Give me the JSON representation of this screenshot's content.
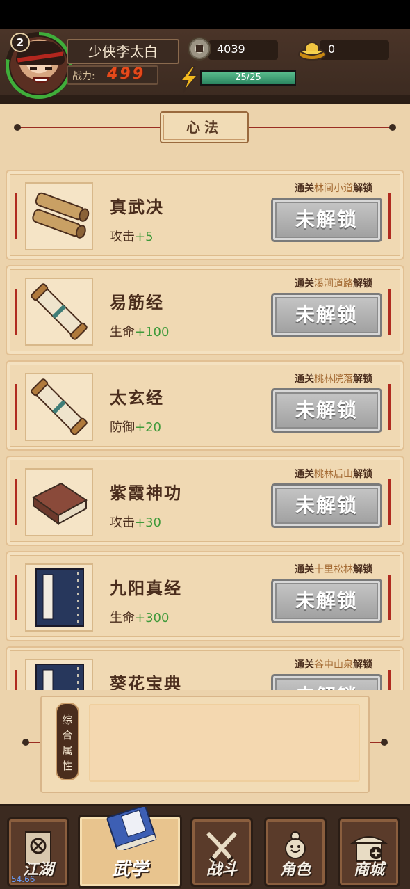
{
  "player": {
    "level": "2",
    "name": "少侠李太白",
    "power_label": "战力:",
    "power_value": "499",
    "coins": "4039",
    "ingots": "0",
    "energy_text": "25/25",
    "energy_fraction": 1.0
  },
  "section": {
    "title": "心法"
  },
  "skills": [
    {
      "name": "真武决",
      "stat_label": "攻击",
      "stat_bonus": "+5",
      "hint_pre": "通关",
      "stage": "林间小道",
      "hint_post": "解锁",
      "button": "未解锁",
      "icon": "bamboo-scrolls-icon"
    },
    {
      "name": "易筋经",
      "stat_label": "生命",
      "stat_bonus": "+100",
      "hint_pre": "通关",
      "stage": "溪涧道路",
      "hint_post": "解锁",
      "button": "未解锁",
      "icon": "rolled-scroll-icon"
    },
    {
      "name": "太玄经",
      "stat_label": "防御",
      "stat_bonus": "+20",
      "hint_pre": "通关",
      "stage": "桃林院落",
      "hint_post": "解锁",
      "button": "未解锁",
      "icon": "rolled-scroll-icon"
    },
    {
      "name": "紫霞神功",
      "stat_label": "攻击",
      "stat_bonus": "+30",
      "hint_pre": "通关",
      "stage": "桃林后山",
      "hint_post": "解锁",
      "button": "未解锁",
      "icon": "brown-book-icon"
    },
    {
      "name": "九阳真经",
      "stat_label": "生命",
      "stat_bonus": "+300",
      "hint_pre": "通关",
      "stage": "十里松林",
      "hint_post": "解锁",
      "button": "未解锁",
      "icon": "blue-book-icon"
    },
    {
      "name": "葵花宝典",
      "stat_label": "",
      "stat_bonus": "",
      "hint_pre": "通关",
      "stage": "谷中山泉",
      "hint_post": "解锁",
      "button": "未解锁",
      "icon": "blue-book-icon"
    }
  ],
  "attributes": {
    "label": "综合属性"
  },
  "nav": {
    "tabs": [
      {
        "label": "江湖",
        "icon": "banner-icon",
        "active": false
      },
      {
        "label": "武学",
        "icon": "martial-book-icon",
        "active": true
      },
      {
        "label": "战斗",
        "icon": "crossed-swords-icon",
        "active": false
      },
      {
        "label": "角色",
        "icon": "character-icon",
        "active": false
      },
      {
        "label": "商城",
        "icon": "shop-icon",
        "active": false
      }
    ]
  },
  "fps": "54.66",
  "colors": {
    "bonus_green": "#3f9a3a",
    "stage_brown": "#a56c35",
    "accent_red": "#b02b1f",
    "locked_gray": "#9e9e9e"
  }
}
